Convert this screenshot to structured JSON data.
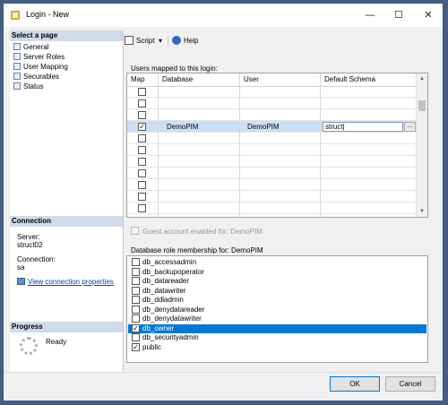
{
  "window": {
    "title": "Login - New",
    "minimize": "—",
    "maximize": "☐",
    "close": "✕"
  },
  "left": {
    "select_page_header": "Select a page",
    "pages": [
      "General",
      "Server Roles",
      "User Mapping",
      "Securables",
      "Status"
    ],
    "connection_header": "Connection",
    "server_label": "Server:",
    "server_value": "struct02",
    "connection_label": "Connection:",
    "connection_value": "sa",
    "view_connection_link": "View connection properties",
    "progress_header": "Progress",
    "progress_status": "Ready"
  },
  "toolbar": {
    "script_label": "Script",
    "help_label": "Help"
  },
  "mapping": {
    "label": "Users mapped to this login:",
    "columns": [
      "Map",
      "Database",
      "User",
      "Default Schema"
    ],
    "rows": [
      {
        "map": false,
        "database": "",
        "user": "",
        "schema": ""
      },
      {
        "map": false,
        "database": "",
        "user": "",
        "schema": ""
      },
      {
        "map": false,
        "database": "",
        "user": "",
        "schema": ""
      },
      {
        "map": true,
        "database": "DemoPIM",
        "user": "DemoPIM",
        "schema": "struct|"
      },
      {
        "map": false,
        "database": "",
        "user": "",
        "schema": ""
      },
      {
        "map": false,
        "database": "",
        "user": "",
        "schema": ""
      },
      {
        "map": false,
        "database": "",
        "user": "",
        "schema": ""
      },
      {
        "map": false,
        "database": "",
        "user": "",
        "schema": ""
      },
      {
        "map": false,
        "database": "",
        "user": "",
        "schema": ""
      },
      {
        "map": false,
        "database": "",
        "user": "",
        "schema": ""
      },
      {
        "map": false,
        "database": "",
        "user": "",
        "schema": ""
      }
    ],
    "browse_button": "..."
  },
  "guest_label": "Guest account enabled for: DemoPIM",
  "roles": {
    "label": "Database role membership for: DemoPIM",
    "items": [
      {
        "name": "db_accessadmin",
        "checked": false
      },
      {
        "name": "db_backupoperator",
        "checked": false
      },
      {
        "name": "db_datareader",
        "checked": false
      },
      {
        "name": "db_datawriter",
        "checked": false
      },
      {
        "name": "db_ddladmin",
        "checked": false
      },
      {
        "name": "db_denydatareader",
        "checked": false
      },
      {
        "name": "db_denydatawriter",
        "checked": false
      },
      {
        "name": "db_owner",
        "checked": true
      },
      {
        "name": "db_securityadmin",
        "checked": false
      },
      {
        "name": "public",
        "checked": true
      }
    ]
  },
  "buttons": {
    "ok": "OK",
    "cancel": "Cancel"
  }
}
